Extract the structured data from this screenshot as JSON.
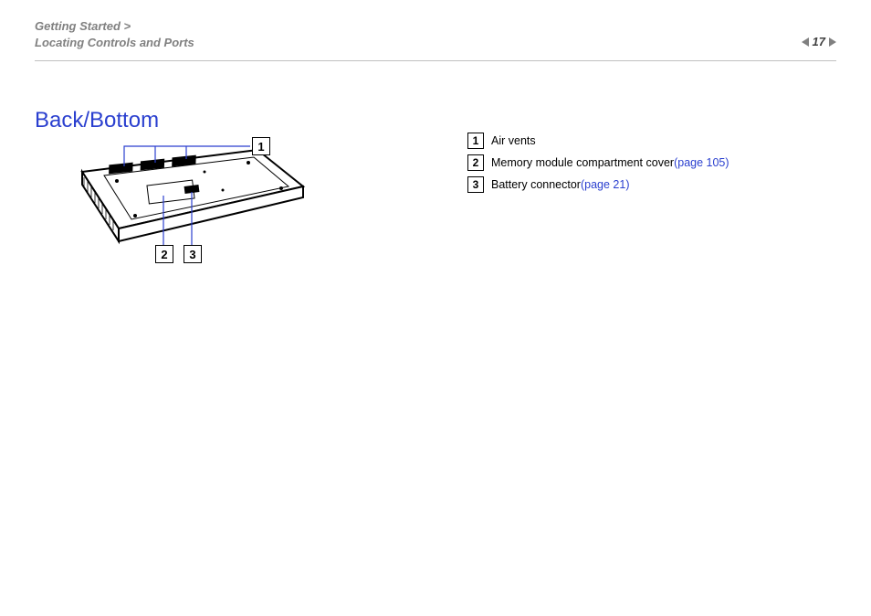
{
  "header": {
    "breadcrumb_line1": "Getting Started >",
    "breadcrumb_line2": "Locating Controls and Ports",
    "page_number": "17"
  },
  "title": "Back/Bottom",
  "legend": [
    {
      "num": "1",
      "text": "Air vents",
      "link": ""
    },
    {
      "num": "2",
      "text": "Memory module compartment cover ",
      "link": "(page 105)"
    },
    {
      "num": "3",
      "text": "Battery connector ",
      "link": "(page 21)"
    }
  ],
  "callouts": {
    "c1": "1",
    "c2": "2",
    "c3": "3"
  },
  "figure_alt": "laptop-bottom-illustration"
}
